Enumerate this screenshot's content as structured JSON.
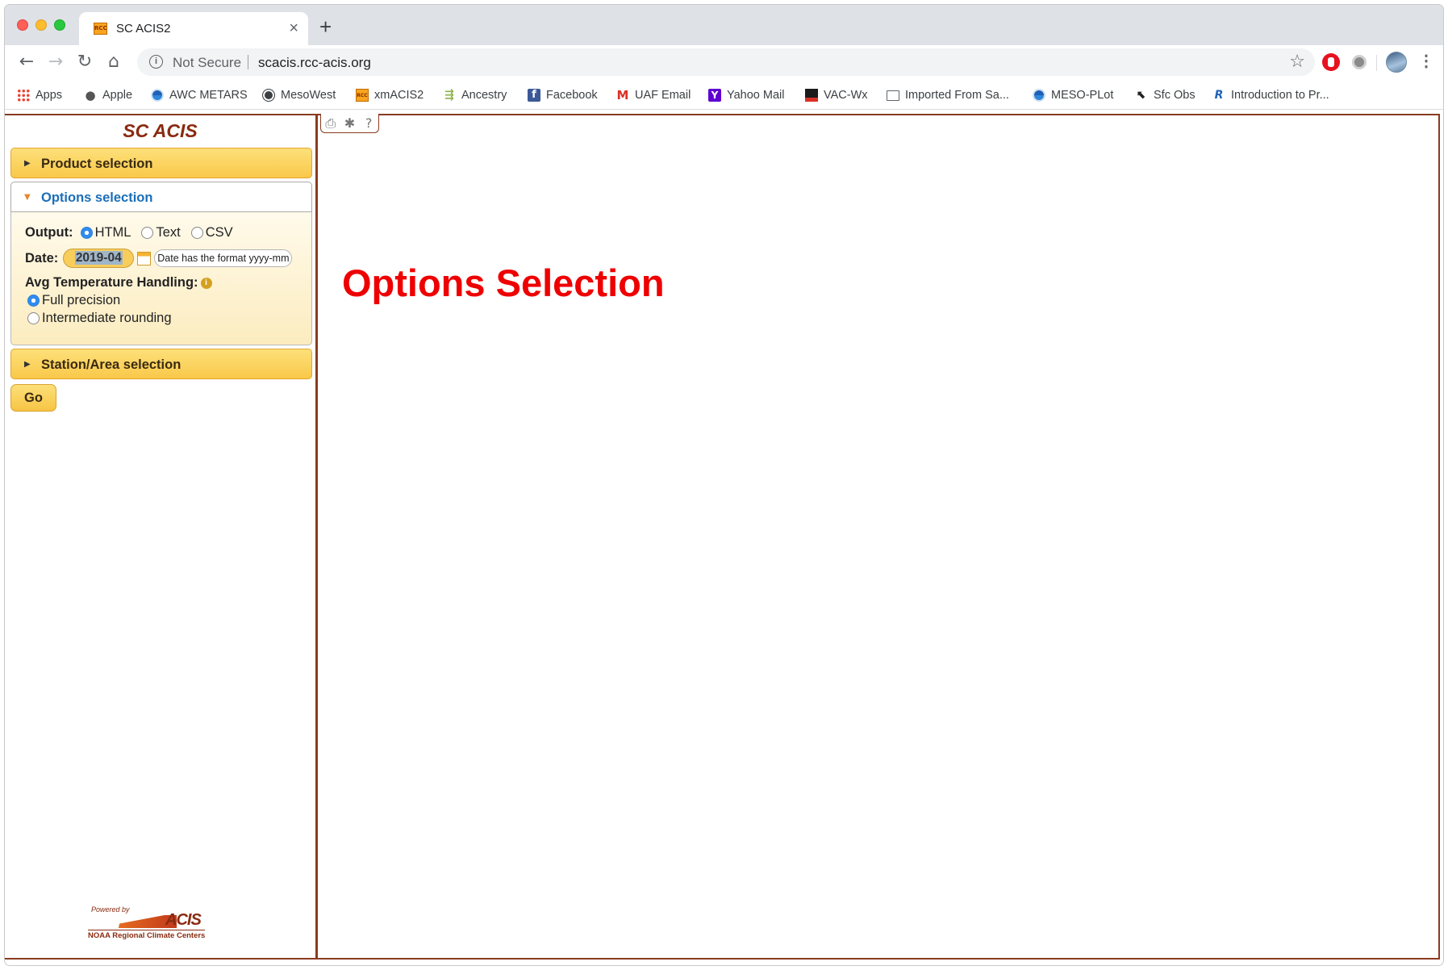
{
  "browser": {
    "tab_title": "SC ACIS2",
    "tab_favicon_text": "RCC",
    "close_glyph": "×",
    "new_tab_glyph": "+",
    "security_label": "Not Secure",
    "url": "scacis.rcc-acis.org",
    "menu_glyph": "⋮"
  },
  "bookmarks": [
    {
      "label": "Apps",
      "icon": "apps-grid-icon"
    },
    {
      "label": "Apple",
      "icon": "apple-icon"
    },
    {
      "label": "AWC METARS",
      "icon": "noaa-icon"
    },
    {
      "label": "MesoWest",
      "icon": "globe-icon"
    },
    {
      "label": "xmACIS2",
      "icon": "acis-icon"
    },
    {
      "label": "Ancestry",
      "icon": "leaf-icon"
    },
    {
      "label": "Facebook",
      "icon": "facebook-icon"
    },
    {
      "label": "UAF Email",
      "icon": "gmail-icon"
    },
    {
      "label": "Yahoo Mail",
      "icon": "yahoo-icon"
    },
    {
      "label": "VAC-Wx",
      "icon": "weather-icon"
    },
    {
      "label": "Imported From Sa...",
      "icon": "folder-icon"
    },
    {
      "label": "MESO-PLot",
      "icon": "noaa-icon"
    },
    {
      "label": "Sfc Obs",
      "icon": "cursor-icon"
    },
    {
      "label": "Introduction to Pr...",
      "icon": "r-icon"
    }
  ],
  "sidebar": {
    "app_title": "SC ACIS",
    "product_header": "Product selection",
    "options_header": "Options selection",
    "station_header": "Station/Area selection",
    "output_label": "Output:",
    "output_options": [
      "HTML",
      "Text",
      "CSV"
    ],
    "output_selected": "HTML",
    "date_label": "Date:",
    "date_value": "2019-04",
    "date_hint": "Date has the format yyyy-mm",
    "avg_label": "Avg Temperature Handling:",
    "avg_options": [
      "Full precision",
      "Intermediate rounding"
    ],
    "avg_selected": "Full precision",
    "go_label": "Go",
    "powered_by": "Powered by",
    "logo_text": "ACIS",
    "logo_sub": "NOAA Regional Climate Centers"
  },
  "main": {
    "tools": [
      "print-icon",
      "gear-icon",
      "help-icon"
    ],
    "help_glyph": "?",
    "annotation": "Options Selection"
  },
  "colors": {
    "accent_gold": "#f9c84a",
    "frame_brown": "#8a3a20",
    "annotation_red": "#ee0000",
    "link_blue": "#1b6fb8"
  }
}
